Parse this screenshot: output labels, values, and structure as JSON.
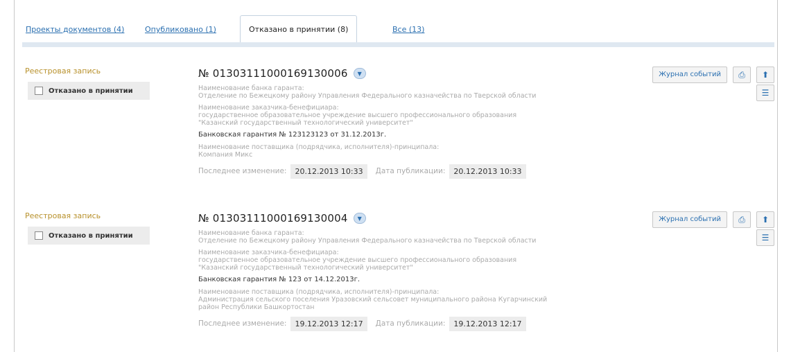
{
  "tabs": [
    {
      "label": "Проекты документов (4)"
    },
    {
      "label": "Опубликовано (1)"
    },
    {
      "label": "Отказано в принятии (8)"
    },
    {
      "label": "Все (13)"
    }
  ],
  "records": [
    {
      "registry_label": "Реестровая запись",
      "status": "Отказано в принятии",
      "number": "№ 01303111000169130006",
      "bank_label": "Наименование банка гаранта:",
      "bank_value": "Отделение по Бежецкому району Управления Федерального казначейства по Тверской области",
      "customer_label": "Наименование заказчика-бенефициара:",
      "customer_value_1": "государственное образовательное учреждение высшего профессионального образования",
      "customer_value_2": "\"Казанский государственный технологический университет\"",
      "guarantee": "Банковская гарантия № 123123123 от 31.12.2013г.",
      "supplier_label": "Наименование поставщика (подрядчика, исполнителя)-принципала:",
      "supplier_value_1": "Компания Микс",
      "supplier_value_2": "",
      "last_change_label": "Последнее изменение:",
      "last_change": "20.12.2013 10:33",
      "publish_label": "Дата публикации:",
      "publish_date": "20.12.2013 10:33",
      "log_button": "Журнал событий"
    },
    {
      "registry_label": "Реестровая запись",
      "status": "Отказано в принятии",
      "number": "№ 01303111000169130004",
      "bank_label": "Наименование банка гаранта:",
      "bank_value": "Отделение по Бежецкому району Управления Федерального казначейства по Тверской области",
      "customer_label": "Наименование заказчика-бенефициара:",
      "customer_value_1": "государственное образовательное учреждение высшего профессионального образования",
      "customer_value_2": "\"Казанский государственный технологический университет\"",
      "guarantee": "Банковская гарантия № 123 от 14.12.2013г.",
      "supplier_label": "Наименование поставщика (подрядчика, исполнителя)-принципала:",
      "supplier_value_1": "Администрация сельского поселения Уразовский сельсовет муниципального района Кугарчинский",
      "supplier_value_2": "район Республики Башкортостан",
      "last_change_label": "Последнее изменение:",
      "last_change": "19.12.2013 12:17",
      "publish_label": "Дата публикации:",
      "publish_date": "19.12.2013 12:17",
      "log_button": "Журнал событий"
    }
  ],
  "icons": {
    "dropdown": "chevron-down-icon",
    "print": "print-icon",
    "pin": "pin-icon",
    "document": "document-icon"
  },
  "colors": {
    "link": "#2a6fb0",
    "registry_label": "#b8912c",
    "tab_bar": "#dfe8f1"
  }
}
